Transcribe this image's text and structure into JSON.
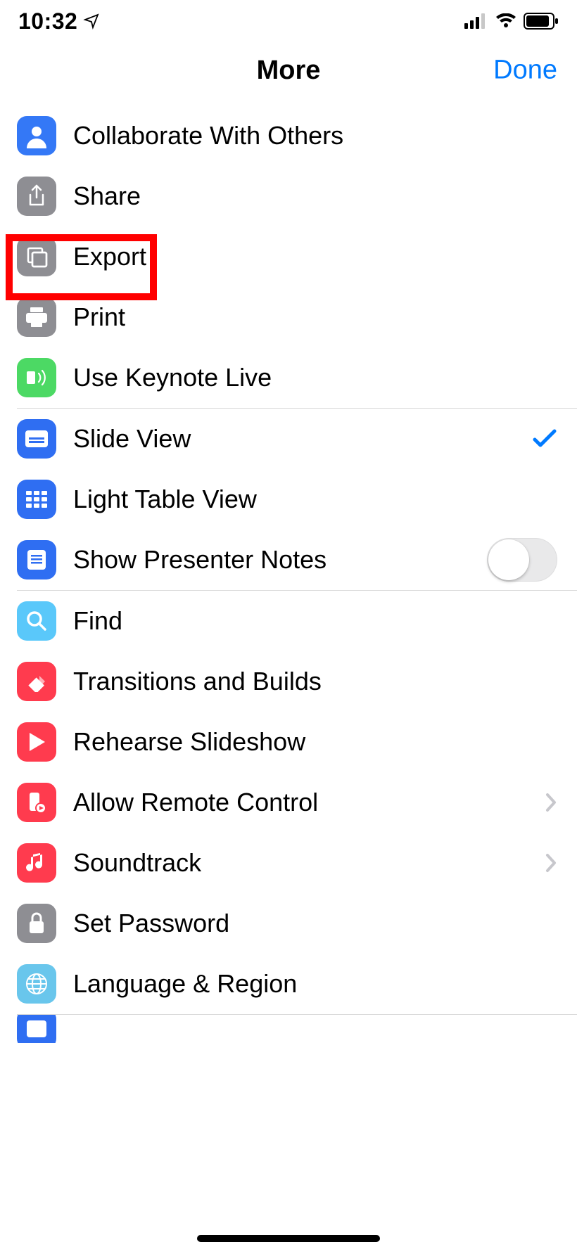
{
  "status_bar": {
    "time": "10:32"
  },
  "header": {
    "title": "More",
    "done_label": "Done"
  },
  "items": {
    "collaborate": "Collaborate With Others",
    "share": "Share",
    "export": "Export",
    "print": "Print",
    "keynote_live": "Use Keynote Live",
    "slide_view": "Slide View",
    "light_table": "Light Table View",
    "presenter_notes": "Show Presenter Notes",
    "find": "Find",
    "transitions": "Transitions and Builds",
    "rehearse": "Rehearse Slideshow",
    "remote": "Allow Remote Control",
    "soundtrack": "Soundtrack",
    "set_password": "Set Password",
    "language_region": "Language & Region"
  },
  "state": {
    "selected_view": "slide_view",
    "presenter_notes_on": false
  }
}
